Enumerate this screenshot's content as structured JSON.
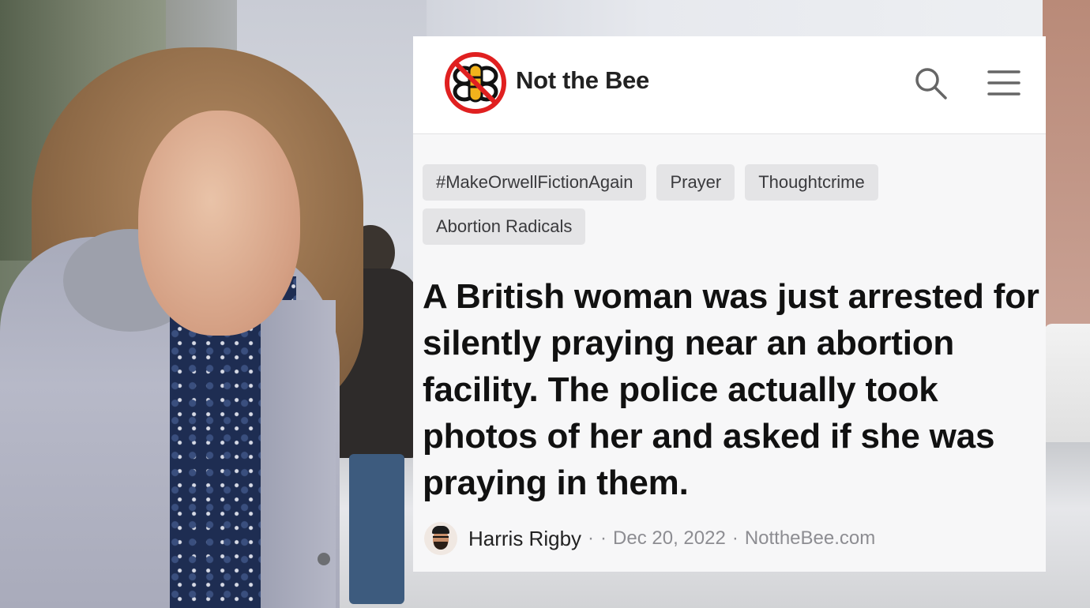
{
  "site": {
    "brand": "Not the Bee",
    "logo_icon": "not-the-bee-logo",
    "accent_color": "#e02020",
    "search_icon": "search-icon",
    "menu_icon": "hamburger-menu-icon"
  },
  "tags": [
    "#MakeOrwellFictionAgain",
    "Prayer",
    "Thoughtcrime",
    "Abortion Radicals"
  ],
  "article": {
    "headline": "A British woman was just arrested for silently praying near an abortion facility. The police actually took photos of her and asked if she was praying in them.",
    "author": "Harris Rigby",
    "separator_1": "·",
    "separator_2": "·",
    "date": "Dec 20, 2022",
    "separator_3": "·",
    "source": "NottheBee.com"
  }
}
